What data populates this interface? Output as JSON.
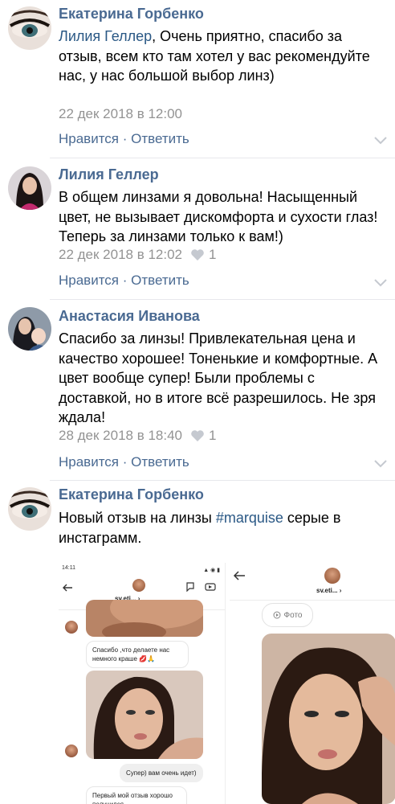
{
  "comments": [
    {
      "author": "Екатерина Горбенко",
      "reply_to": "Лилия Геллер",
      "text": ", Очень приятно, спасибо за отзыв, всем кто там хотел у вас рекомендуйте нас, у нас большой выбор линз)",
      "date": "22 дек 2018 в 12:00",
      "likes": "",
      "like_label": "Нравится",
      "separator": " · ",
      "reply_label": "Ответить"
    },
    {
      "author": "Лилия Геллер",
      "text": "В общем линзами я довольна! Насыщенный цвет, не вызывает дискомфорта и сухости глаз! Теперь за линзами только к вам!)",
      "date": "22 дек 2018 в 12:02",
      "likes": "1",
      "like_label": "Нравится",
      "separator": " · ",
      "reply_label": "Ответить"
    },
    {
      "author": "Анастасия Иванова",
      "text": "Спасибо за линзы! Привлекательная цена и качество хорошее! Тоненькие и комфортные. А цвет вообще супер! Были проблемы с доставкой, но в итоге всё разрешилось. Не зря ждала!",
      "date": "28 дек 2018 в 18:40",
      "likes": "1",
      "like_label": "Нравится",
      "separator": " · ",
      "reply_label": "Ответить"
    },
    {
      "author": "Екатерина Горбенко",
      "text_before": "Новый отзыв на линзы ",
      "hashtag": "#marquise",
      "text_after": " серые в инстаграмм."
    }
  ],
  "attachment": {
    "left": {
      "time": "14:11",
      "status_icons": "▲ ◉ ▮",
      "username": "sv.eti...",
      "chevron": "›",
      "msg1": "Спасибо ,что делаете нас немного краше 💋🙏",
      "msg2": "Супер) вам очень идет)",
      "msg3": "Первый мой отзыв хорошо получился"
    },
    "right": {
      "username": "sv.eti...",
      "chevron": "›",
      "photo_label": "Фото"
    }
  },
  "colors": {
    "link": "#4a6a92",
    "meta": "#939393",
    "divider": "#e7e8ec"
  },
  "icons": [
    "heart-icon",
    "chevron-down-icon",
    "back-arrow-icon",
    "flag-icon",
    "video-icon",
    "photo-icon"
  ]
}
